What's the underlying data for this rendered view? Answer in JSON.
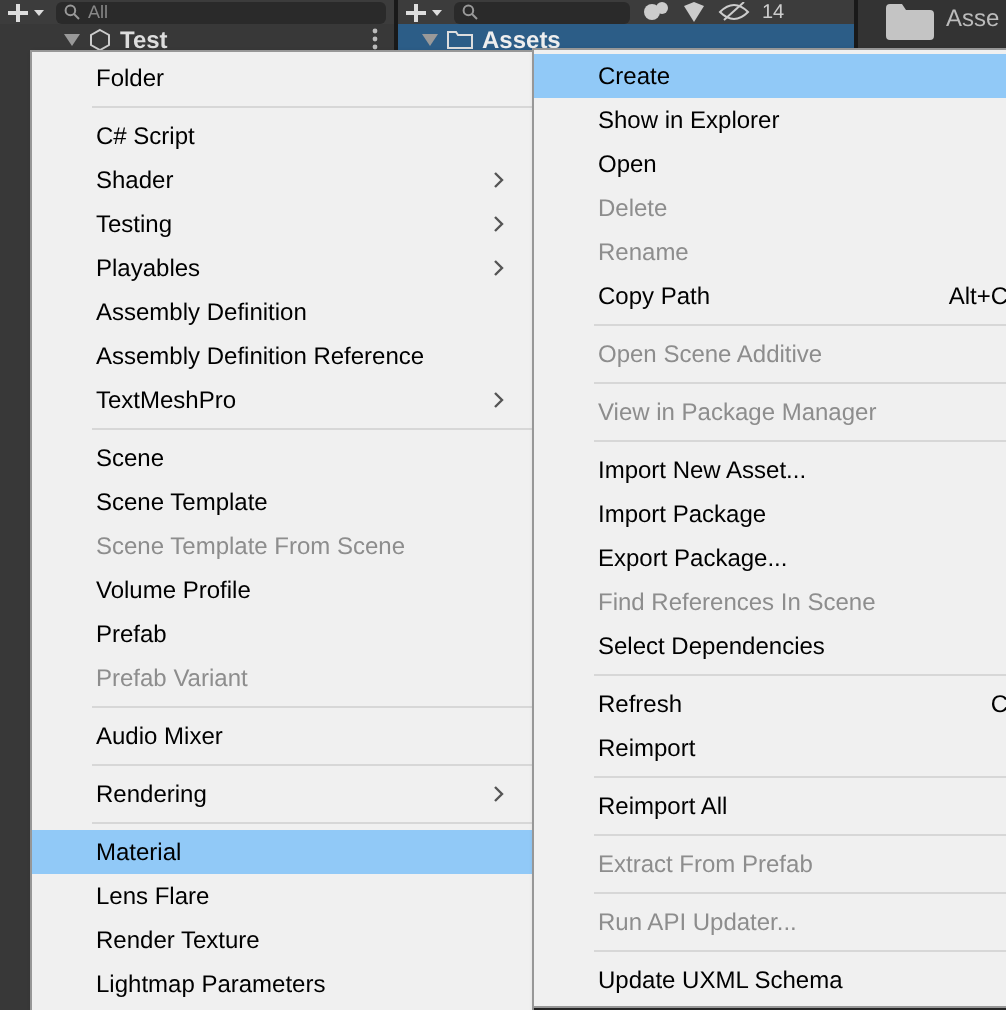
{
  "hierarchy": {
    "search": {
      "placeholder": "All"
    },
    "scene": {
      "name": "Test",
      "expanded": true
    }
  },
  "project": {
    "hidden_count": "14",
    "tree": [
      {
        "name": "Assets",
        "selected": true,
        "expanded": true
      }
    ],
    "breadcrumb": "Asse"
  },
  "create_menu": {
    "items": [
      {
        "kind": "item",
        "label": "Folder",
        "disabled": false,
        "submenu": false,
        "selected": false
      },
      {
        "kind": "separator"
      },
      {
        "kind": "item",
        "label": "C# Script",
        "disabled": false,
        "submenu": false,
        "selected": false
      },
      {
        "kind": "item",
        "label": "Shader",
        "disabled": false,
        "submenu": true,
        "selected": false
      },
      {
        "kind": "item",
        "label": "Testing",
        "disabled": false,
        "submenu": true,
        "selected": false
      },
      {
        "kind": "item",
        "label": "Playables",
        "disabled": false,
        "submenu": true,
        "selected": false
      },
      {
        "kind": "item",
        "label": "Assembly Definition",
        "disabled": false,
        "submenu": false,
        "selected": false
      },
      {
        "kind": "item",
        "label": "Assembly Definition Reference",
        "disabled": false,
        "submenu": false,
        "selected": false
      },
      {
        "kind": "item",
        "label": "TextMeshPro",
        "disabled": false,
        "submenu": true,
        "selected": false
      },
      {
        "kind": "separator"
      },
      {
        "kind": "item",
        "label": "Scene",
        "disabled": false,
        "submenu": false,
        "selected": false
      },
      {
        "kind": "item",
        "label": "Scene Template",
        "disabled": false,
        "submenu": false,
        "selected": false
      },
      {
        "kind": "item",
        "label": "Scene Template From Scene",
        "disabled": true,
        "submenu": false,
        "selected": false
      },
      {
        "kind": "item",
        "label": "Volume Profile",
        "disabled": false,
        "submenu": false,
        "selected": false
      },
      {
        "kind": "item",
        "label": "Prefab",
        "disabled": false,
        "submenu": false,
        "selected": false
      },
      {
        "kind": "item",
        "label": "Prefab Variant",
        "disabled": true,
        "submenu": false,
        "selected": false
      },
      {
        "kind": "separator"
      },
      {
        "kind": "item",
        "label": "Audio Mixer",
        "disabled": false,
        "submenu": false,
        "selected": false
      },
      {
        "kind": "separator"
      },
      {
        "kind": "item",
        "label": "Rendering",
        "disabled": false,
        "submenu": true,
        "selected": false
      },
      {
        "kind": "separator"
      },
      {
        "kind": "item",
        "label": "Material",
        "disabled": false,
        "submenu": false,
        "selected": true
      },
      {
        "kind": "item",
        "label": "Lens Flare",
        "disabled": false,
        "submenu": false,
        "selected": false
      },
      {
        "kind": "item",
        "label": "Render Texture",
        "disabled": false,
        "submenu": false,
        "selected": false
      },
      {
        "kind": "item",
        "label": "Lightmap Parameters",
        "disabled": false,
        "submenu": false,
        "selected": false
      }
    ]
  },
  "context_menu": {
    "items": [
      {
        "kind": "item",
        "label": "Create",
        "disabled": false,
        "selected": true
      },
      {
        "kind": "item",
        "label": "Show in Explorer",
        "disabled": false,
        "selected": false
      },
      {
        "kind": "item",
        "label": "Open",
        "disabled": false,
        "selected": false
      },
      {
        "kind": "item",
        "label": "Delete",
        "disabled": true,
        "selected": false
      },
      {
        "kind": "item",
        "label": "Rename",
        "disabled": true,
        "selected": false
      },
      {
        "kind": "item",
        "label": "Copy Path",
        "shortcut": "Alt+C",
        "disabled": false,
        "selected": false
      },
      {
        "kind": "separator"
      },
      {
        "kind": "item",
        "label": "Open Scene Additive",
        "disabled": true,
        "selected": false
      },
      {
        "kind": "separator"
      },
      {
        "kind": "item",
        "label": "View in Package Manager",
        "disabled": true,
        "selected": false
      },
      {
        "kind": "separator"
      },
      {
        "kind": "item",
        "label": "Import New Asset...",
        "disabled": false,
        "selected": false
      },
      {
        "kind": "item",
        "label": "Import Package",
        "disabled": false,
        "selected": false
      },
      {
        "kind": "item",
        "label": "Export Package...",
        "disabled": false,
        "selected": false
      },
      {
        "kind": "item",
        "label": "Find References In Scene",
        "disabled": true,
        "selected": false
      },
      {
        "kind": "item",
        "label": "Select Dependencies",
        "disabled": false,
        "selected": false
      },
      {
        "kind": "separator"
      },
      {
        "kind": "item",
        "label": "Refresh",
        "shortcut": "C",
        "disabled": false,
        "selected": false
      },
      {
        "kind": "item",
        "label": "Reimport",
        "disabled": false,
        "selected": false
      },
      {
        "kind": "separator"
      },
      {
        "kind": "item",
        "label": "Reimport All",
        "disabled": false,
        "selected": false
      },
      {
        "kind": "separator"
      },
      {
        "kind": "item",
        "label": "Extract From Prefab",
        "disabled": true,
        "selected": false
      },
      {
        "kind": "separator"
      },
      {
        "kind": "item",
        "label": "Run API Updater...",
        "disabled": true,
        "selected": false
      },
      {
        "kind": "separator"
      },
      {
        "kind": "item",
        "label": "Update UXML Schema",
        "disabled": false,
        "selected": false
      }
    ]
  }
}
